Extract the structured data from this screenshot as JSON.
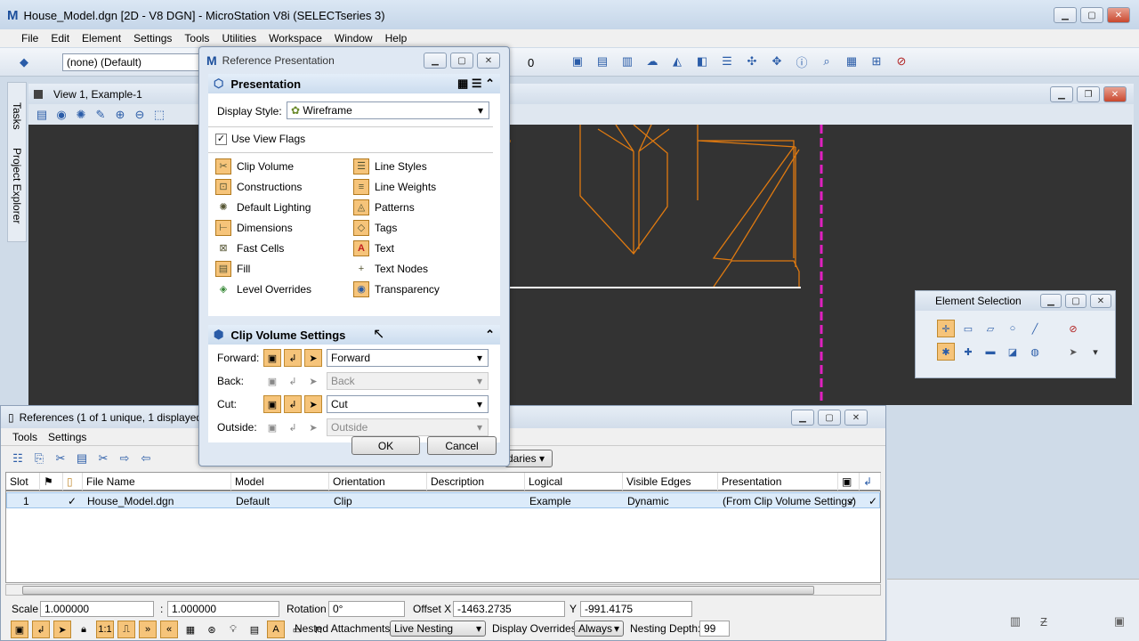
{
  "app": {
    "title": "House_Model.dgn [2D - V8 DGN] - MicroStation V8i (SELECTseries 3)"
  },
  "menu": [
    "File",
    "Edit",
    "Element",
    "Settings",
    "Tools",
    "Utilities",
    "Workspace",
    "Window",
    "Help"
  ],
  "toolbar": {
    "level_combo": "(none) (Default)",
    "weight_value": "0"
  },
  "tasks": {
    "tasks_label": "Tasks",
    "explorer_label": "Project Explorer"
  },
  "view": {
    "title": "View 1, Example-1"
  },
  "element_selection": {
    "title": "Element Selection"
  },
  "dialog": {
    "title": "Reference Presentation",
    "presentation_header": "Presentation",
    "display_style_label": "Display Style:",
    "display_style_value": "Wireframe",
    "use_view_flags_label": "Use View Flags",
    "use_view_flags_checked": true,
    "flags_left": [
      "Clip Volume",
      "Constructions",
      "Default Lighting",
      "Dimensions",
      "Fast Cells",
      "Fill",
      "Level Overrides"
    ],
    "flags_right": [
      "Line Styles",
      "Line Weights",
      "Patterns",
      "Tags",
      "Text",
      "Text Nodes",
      "Transparency"
    ],
    "clip_header": "Clip Volume Settings",
    "clip_rows": [
      {
        "label": "Forward:",
        "value": "Forward",
        "enabled": true
      },
      {
        "label": "Back:",
        "value": "Back",
        "enabled": false
      },
      {
        "label": "Cut:",
        "value": "Cut",
        "enabled": true
      },
      {
        "label": "Outside:",
        "value": "Outside",
        "enabled": false
      }
    ],
    "ok_label": "OK",
    "cancel_label": "Cancel"
  },
  "references": {
    "title": "References (1 of 1 unique, 1 displayed)",
    "menu": [
      "Tools",
      "Settings"
    ],
    "boundaries_combo": "daries",
    "columns": [
      "Slot",
      "",
      "",
      "File Name",
      "Model",
      "Orientation",
      "Description",
      "Logical",
      "Visible Edges",
      "Presentation",
      "",
      ""
    ],
    "rows": [
      {
        "slot": "1",
        "check": "✓",
        "file": "House_Model.dgn",
        "model": "Default",
        "orientation": "Clip",
        "description": "",
        "logical": "Example",
        "visible_edges": "Dynamic",
        "presentation": "(From Clip Volume Settings)",
        "c1": "✓",
        "c2": "✓"
      }
    ],
    "scale_label": "Scale",
    "scale1": "1.000000",
    "scale2": "1.000000",
    "rotation_label": "Rotation",
    "rotation": "0°",
    "offset_x_label": "Offset X",
    "offset_x": "-1463.2735",
    "offset_y_label": "Y",
    "offset_y": "-991.4175",
    "nested_label": "Nested Attachments:",
    "nested_value": "Live Nesting",
    "overrides_label": "Display Overrides:",
    "overrides_value": "Always",
    "depth_label": "Nesting Depth:",
    "depth_value": "99"
  },
  "colors": {
    "viewport": "#333333",
    "geometry": "#e07a10",
    "clip_boundary": "#e020c0",
    "highlight": "#f6c47a"
  }
}
